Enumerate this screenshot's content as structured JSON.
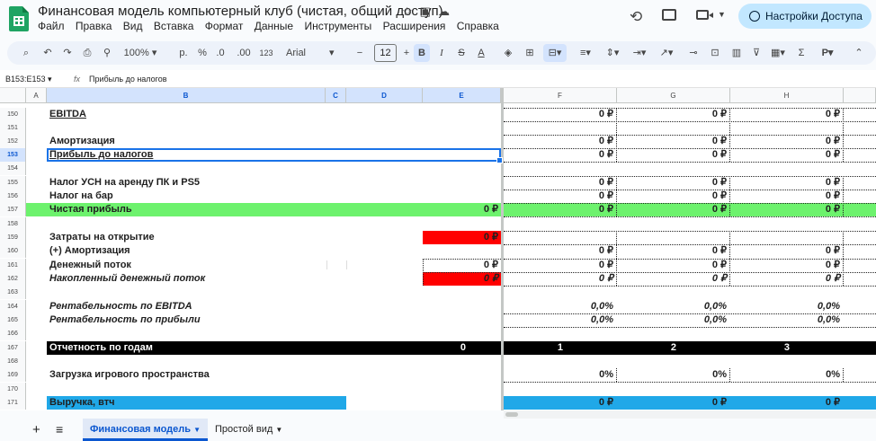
{
  "app": {
    "title": "Финансовая модель компьютерный клуб (чистая, общий доступ)",
    "menu": [
      "Файл",
      "Правка",
      "Вид",
      "Вставка",
      "Формат",
      "Данные",
      "Инструменты",
      "Расширения",
      "Справка"
    ],
    "share_label": "Настройки Доступа"
  },
  "toolbar": {
    "zoom": "100%",
    "currency": "р.",
    "percent": "%",
    "dec_minus": ".0",
    "dec_plus": ".00",
    "number_format": "123",
    "font": "Arial",
    "font_size": "12"
  },
  "formula_bar": {
    "range": "B153:E153",
    "fx": "fx",
    "value": "Прибыль до налогов"
  },
  "columns": [
    "A",
    "B",
    "C",
    "D",
    "E",
    "F",
    "G",
    "H"
  ],
  "rows": {
    "r150": {
      "num": "150",
      "label": "EBITDA",
      "f": "0 ₽",
      "g": "0 ₽",
      "h": "0 ₽"
    },
    "r151": {
      "num": "151"
    },
    "r152": {
      "num": "152",
      "label": "Амортизация",
      "f": "0 ₽",
      "g": "0 ₽",
      "h": "0 ₽"
    },
    "r153": {
      "num": "153",
      "label": "Прибыль до налогов",
      "f": "0 ₽",
      "g": "0 ₽",
      "h": "0 ₽"
    },
    "r154": {
      "num": "154"
    },
    "r155": {
      "num": "155",
      "label": "Налог УСН на аренду ПК и PS5",
      "f": "0 ₽",
      "g": "0 ₽",
      "h": "0 ₽"
    },
    "r156": {
      "num": "156",
      "label": "Налог на бар",
      "f": "0 ₽",
      "g": "0 ₽",
      "h": "0 ₽"
    },
    "r157": {
      "num": "157",
      "label": "Чистая прибыль",
      "e": "0 ₽",
      "f": "0 ₽",
      "g": "0 ₽",
      "h": "0 ₽"
    },
    "r158": {
      "num": "158"
    },
    "r159": {
      "num": "159",
      "label": "Затраты на открытие",
      "e": "0 ₽"
    },
    "r160": {
      "num": "160",
      "label": "(+) Амортизация",
      "f": "0 ₽",
      "g": "0 ₽",
      "h": "0 ₽"
    },
    "r161": {
      "num": "161",
      "label": "Денежный поток",
      "e": "0 ₽",
      "f": "0 ₽",
      "g": "0 ₽",
      "h": "0 ₽"
    },
    "r162": {
      "num": "162",
      "label": "Накопленный денежный поток",
      "e": "0 ₽",
      "f": "0 ₽",
      "g": "0 ₽",
      "h": "0 ₽"
    },
    "r163": {
      "num": "163"
    },
    "r164": {
      "num": "164",
      "label": "Рентабельность по EBITDA",
      "f": "0,0%",
      "g": "0,0%",
      "h": "0,0%"
    },
    "r165": {
      "num": "165",
      "label": "Рентабельность по прибыли",
      "f": "0,0%",
      "g": "0,0%",
      "h": "0,0%"
    },
    "r166": {
      "num": "166"
    },
    "r167": {
      "num": "167",
      "label": "Отчетность по годам",
      "e": "0",
      "f": "1",
      "g": "2",
      "h": "3"
    },
    "r168": {
      "num": "168"
    },
    "r169": {
      "num": "169",
      "label": "Загрузка игрового пространства",
      "f": "0%",
      "g": "0%",
      "h": "0%"
    },
    "r170": {
      "num": "170"
    },
    "r171": {
      "num": "171",
      "label": "Выручка, втч",
      "f": "0 ₽",
      "g": "0 ₽",
      "h": "0 ₽"
    }
  },
  "tabs": {
    "sheet1": "Финансовая модель",
    "sheet2": "Простой вид"
  },
  "colors": {
    "green": "#6df26d",
    "red": "#ff0000",
    "black": "#000000",
    "blue": "#20a8e8",
    "selection": "#1a73e8"
  }
}
